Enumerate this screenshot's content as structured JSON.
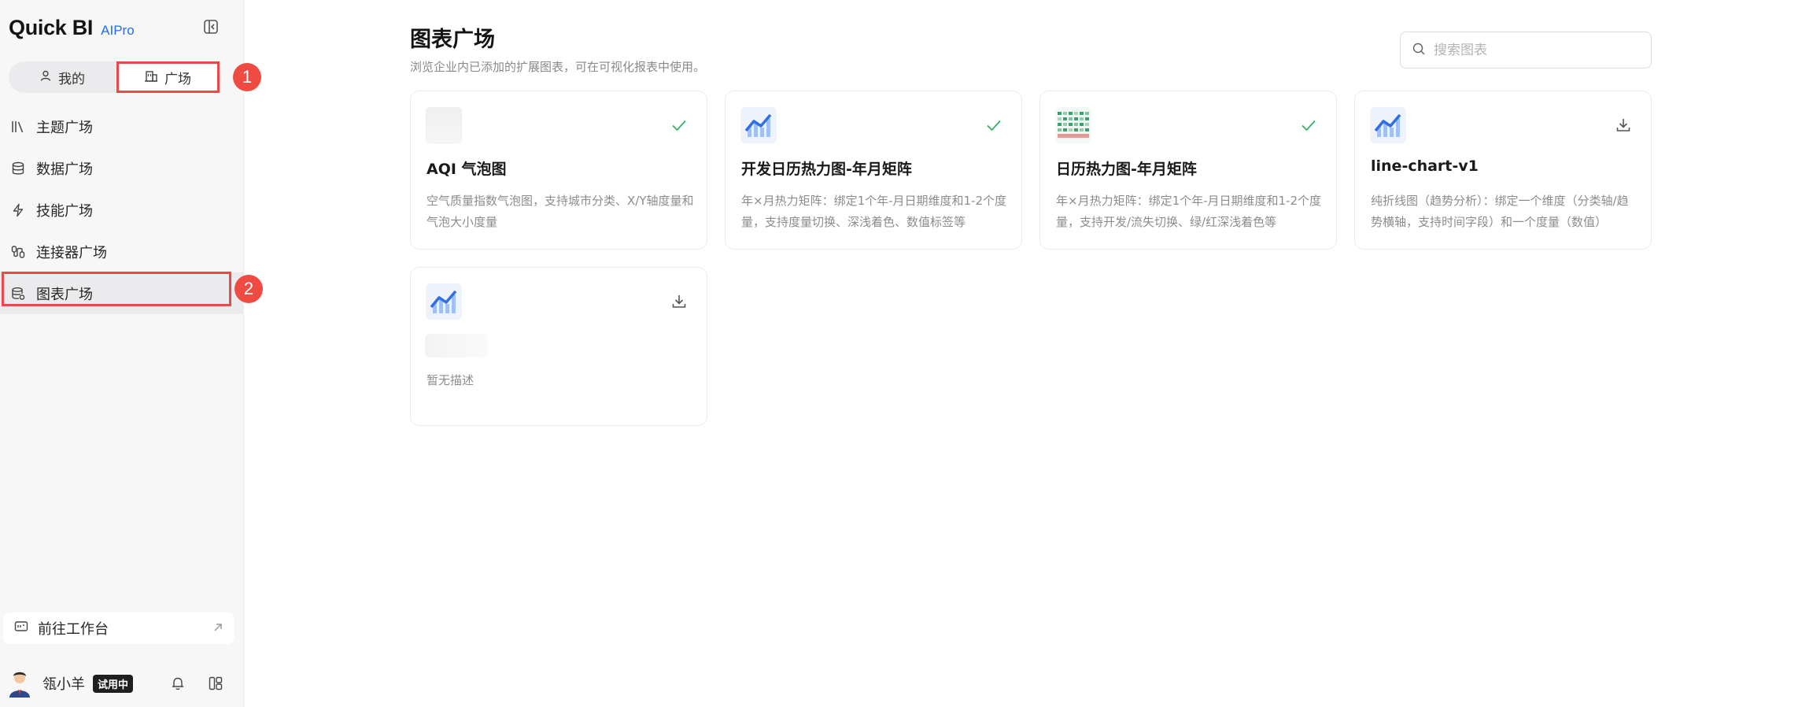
{
  "brand": {
    "name": "Quick BI",
    "sub": "AIPro"
  },
  "switch": {
    "mine": "我的",
    "plaza": "广场"
  },
  "annotations": {
    "one": "1",
    "two": "2"
  },
  "nav": [
    {
      "label": "主题广场",
      "icon": "books-icon"
    },
    {
      "label": "数据广场",
      "icon": "database-icon"
    },
    {
      "label": "技能广场",
      "icon": "lightning-icon"
    },
    {
      "label": "连接器广场",
      "icon": "connector-icon"
    },
    {
      "label": "图表广场",
      "icon": "chart-db-icon",
      "active": true
    }
  ],
  "goto": {
    "label": "前往工作台"
  },
  "user": {
    "name": "瓴小羊",
    "badge": "试用中"
  },
  "page": {
    "title": "图表广场",
    "subtitle": "浏览企业内已添加的扩展图表，可在可视化报表中使用。",
    "search_placeholder": "搜索图表"
  },
  "cards": [
    {
      "name": "AQI 气泡图",
      "desc": "空气质量指数气泡图，支持城市分类、X/Y轴度量和气泡大小度量",
      "status": "added"
    },
    {
      "name": "开发日历热力图-年月矩阵",
      "desc": "年×月热力矩阵：绑定1个年-月日期维度和1-2个度量，支持度量切换、深浅着色、数值标签等",
      "status": "added"
    },
    {
      "name": "日历热力图-年月矩阵",
      "desc": "年×月热力矩阵：绑定1个年-月日期维度和1-2个度量，支持开发/流失切换、绿/红深浅着色等",
      "status": "added"
    },
    {
      "name": "line-chart-v1",
      "desc": "纯折线图（趋势分析）：绑定一个维度（分类轴/趋势横轴，支持时间字段）和一个度量（数值）",
      "status": "download"
    },
    {
      "name": "",
      "desc": "暂无描述",
      "status": "download"
    }
  ],
  "colors": {
    "accent": "#1e6ef4",
    "check": "#35b35f",
    "annotation": "#ef4b43"
  }
}
